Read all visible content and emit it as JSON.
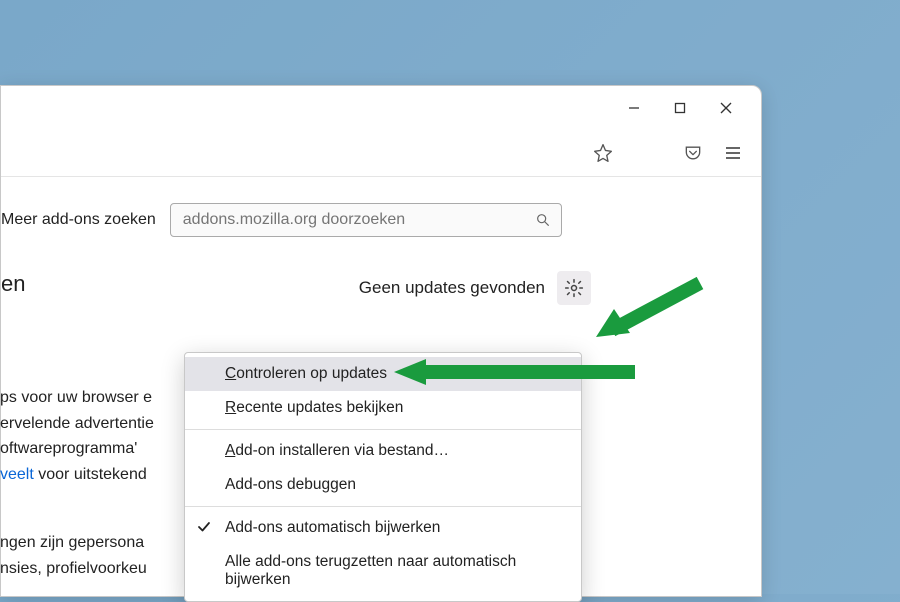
{
  "titlebar": {
    "minimize": "—",
    "maximize": "▢",
    "close": "✕"
  },
  "toolbar": {
    "star": "star-icon",
    "pocket": "pocket-icon",
    "hamburger": "hamburger-icon"
  },
  "search": {
    "label": "Meer add-ons zoeken",
    "placeholder": "addons.mozilla.org doorzoeken"
  },
  "heading_fragment": "en",
  "status_text": "Geen updates gevonden",
  "gear": "gear-icon",
  "menu": {
    "item1_prefix": "C",
    "item1_rest": "ontroleren op updates",
    "item2_prefix": "R",
    "item2_rest": "ecente updates bekijken",
    "item3_prefix": "A",
    "item3_rest": "dd-on installeren via bestand…",
    "item4": "Add-ons debuggen",
    "item5": "Add-ons automatisch bijwerken",
    "item6": "Alle add-ons terugzetten naar automatisch bijwerken"
  },
  "body1": {
    "l1": "ps voor uw browser e",
    "l2": "ervelende advertentie",
    "l3": "oftwareprogramma'",
    "l4a": "veelt",
    "l4b": " voor uitstekend"
  },
  "body2": {
    "l1": "ngen zijn gepersona",
    "l2": "nsies, profielvoorkeu"
  },
  "colors": {
    "arrow": "#1a9b3e"
  }
}
